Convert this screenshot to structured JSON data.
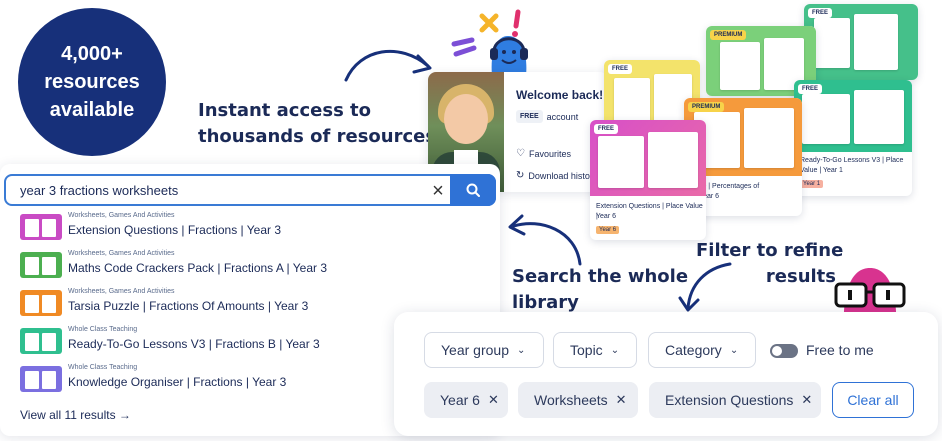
{
  "badge": {
    "line1": "4,000+",
    "line2": "resources",
    "line3": "available"
  },
  "headline_access": {
    "line1": "Instant access to",
    "line2": "thousands of resources"
  },
  "headline_search": {
    "line1": "Search the whole",
    "line2": "library"
  },
  "headline_filter": {
    "line1": "Filter to refine",
    "line2": "results"
  },
  "search": {
    "query": "year 3 fractions worksheets",
    "results": [
      {
        "category": "Worksheets, Games And Activities",
        "title": "Extension Questions | Fractions | Year 3",
        "color": "#c94bc4"
      },
      {
        "category": "Worksheets, Games And Activities",
        "title": "Maths Code Crackers Pack | Fractions A | Year 3",
        "color": "#4caf50"
      },
      {
        "category": "Worksheets, Games And Activities",
        "title": "Tarsia Puzzle | Fractions Of Amounts | Year 3",
        "color": "#f08a24"
      },
      {
        "category": "Whole Class Teaching",
        "title": "Ready-To-Go Lessons V3 | Fractions B | Year 3",
        "color": "#2fbf8f"
      },
      {
        "category": "Whole Class Teaching",
        "title": "Knowledge Organiser | Fractions | Year 3",
        "color": "#7b6fe0"
      }
    ],
    "view_all": "View all 11 results →"
  },
  "account": {
    "welcome": "Welcome back!",
    "tag": "FREE",
    "tag_suffix": "account",
    "favourites": "Favourites",
    "download_history": "Download histo"
  },
  "cards": {
    "free": "FREE",
    "premium": "PREMIUM",
    "extension_title1": "Extension Questions | Place Value |",
    "extension_title2": "Year 6",
    "extension_year": "Year 6",
    "puzzle_title1": "uzzle | Percentages of",
    "puzzle_title2": "s | Year 6",
    "ready_title1": "Ready-To-Go Lessons V3 | Place",
    "ready_title2": "Value | Year 1",
    "ready_year": "Year 1"
  },
  "filters": {
    "dropdowns": [
      "Year group",
      "Topic",
      "Category"
    ],
    "toggle_label": "Free to me",
    "chips": [
      "Year 6",
      "Worksheets",
      "Extension Questions"
    ],
    "clear_all": "Clear all"
  },
  "colors": {
    "navy": "#17307a",
    "accent_blue": "#2f72d6",
    "mascot_blue": "#2f7de1",
    "mascot_pink": "#d8338f"
  }
}
